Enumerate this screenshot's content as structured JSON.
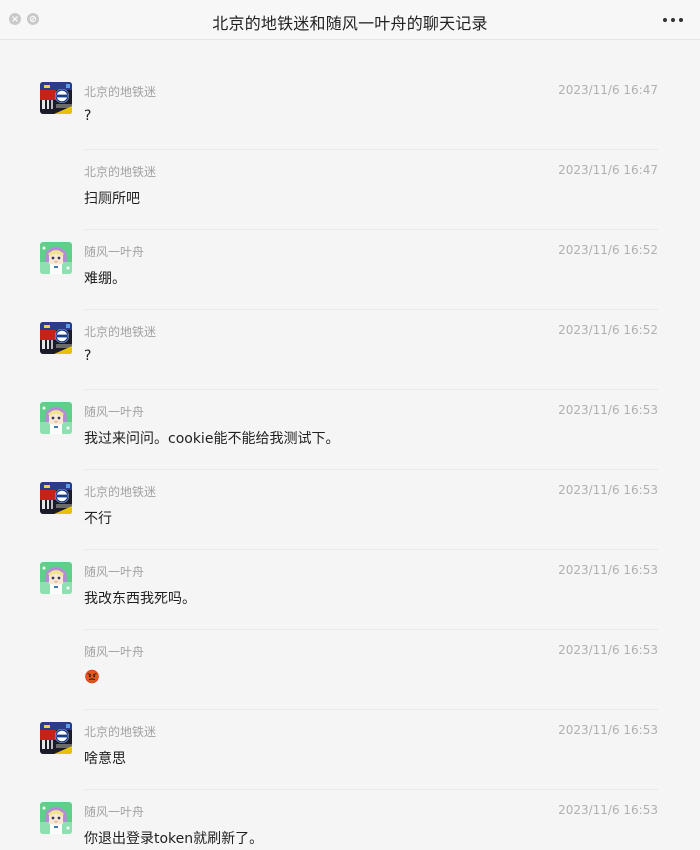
{
  "window": {
    "title": "北京的地铁迷和随风一叶舟的聊天记录",
    "close_icon": "close-icon",
    "minimize_icon": "minimize-icon",
    "more_icon": "more-dots-icon"
  },
  "messages": [
    {
      "sender": "北京的地铁迷",
      "time": "2023/11/6 16:47",
      "text": "?",
      "show_avatar": true,
      "avatar": "metro-avatar"
    },
    {
      "sender": "北京的地铁迷",
      "time": "2023/11/6 16:47",
      "text": "扫厕所吧",
      "show_avatar": false,
      "avatar": "metro-avatar"
    },
    {
      "sender": "随风一叶舟",
      "time": "2023/11/6 16:52",
      "text": "难绷。",
      "show_avatar": true,
      "avatar": "anime-avatar"
    },
    {
      "sender": "北京的地铁迷",
      "time": "2023/11/6 16:52",
      "text": "?",
      "show_avatar": true,
      "avatar": "metro-avatar"
    },
    {
      "sender": "随风一叶舟",
      "time": "2023/11/6 16:53",
      "text": "我过来问问。cookie能不能给我测试下。",
      "show_avatar": true,
      "avatar": "anime-avatar"
    },
    {
      "sender": "北京的地铁迷",
      "time": "2023/11/6 16:53",
      "text": "不行",
      "show_avatar": true,
      "avatar": "metro-avatar"
    },
    {
      "sender": "随风一叶舟",
      "time": "2023/11/6 16:53",
      "text": "我改东西我死吗。",
      "show_avatar": true,
      "avatar": "anime-avatar"
    },
    {
      "sender": "随风一叶舟",
      "time": "2023/11/6 16:53",
      "text": "",
      "emoji": "angry-face-emoji",
      "show_avatar": false,
      "avatar": "anime-avatar"
    },
    {
      "sender": "北京的地铁迷",
      "time": "2023/11/6 16:53",
      "text": "啥意思",
      "show_avatar": true,
      "avatar": "metro-avatar"
    },
    {
      "sender": "随风一叶舟",
      "time": "2023/11/6 16:53",
      "text": "你退出登录token就刷新了。",
      "show_avatar": true,
      "avatar": "anime-avatar"
    }
  ]
}
